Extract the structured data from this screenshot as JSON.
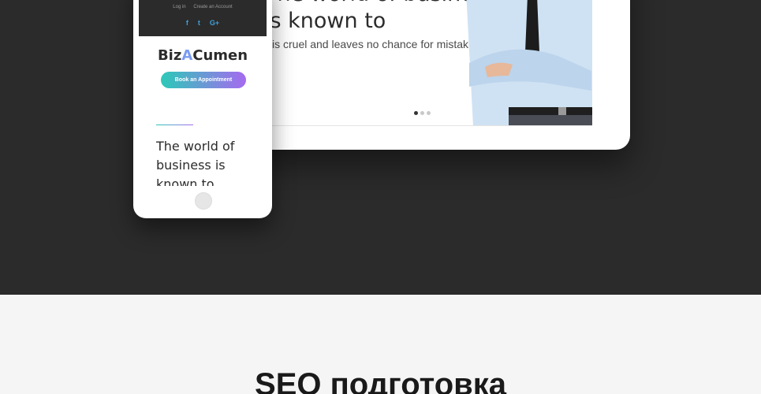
{
  "tablet": {
    "headline_line1": "The world of business",
    "headline_line2": "is known to",
    "subtext": "is cruel and leaves no chance for mistake."
  },
  "phone": {
    "links": {
      "login": "Log in",
      "create_account": "Create an Account"
    },
    "social": [
      "facebook-icon",
      "twitter-icon",
      "google-plus-icon"
    ],
    "logo": {
      "part1": "Biz",
      "part2": "A",
      "part3": "Cumen"
    },
    "cta": "Book an Appointment",
    "headline": "The world of business is known to"
  },
  "section": {
    "heading": "SEO подготовка"
  },
  "colors": {
    "dark_bg": "#2b2b2b",
    "light_bg": "#f5f5f5",
    "gradient_start": "#2cc9b8",
    "gradient_end": "#a66af0"
  }
}
